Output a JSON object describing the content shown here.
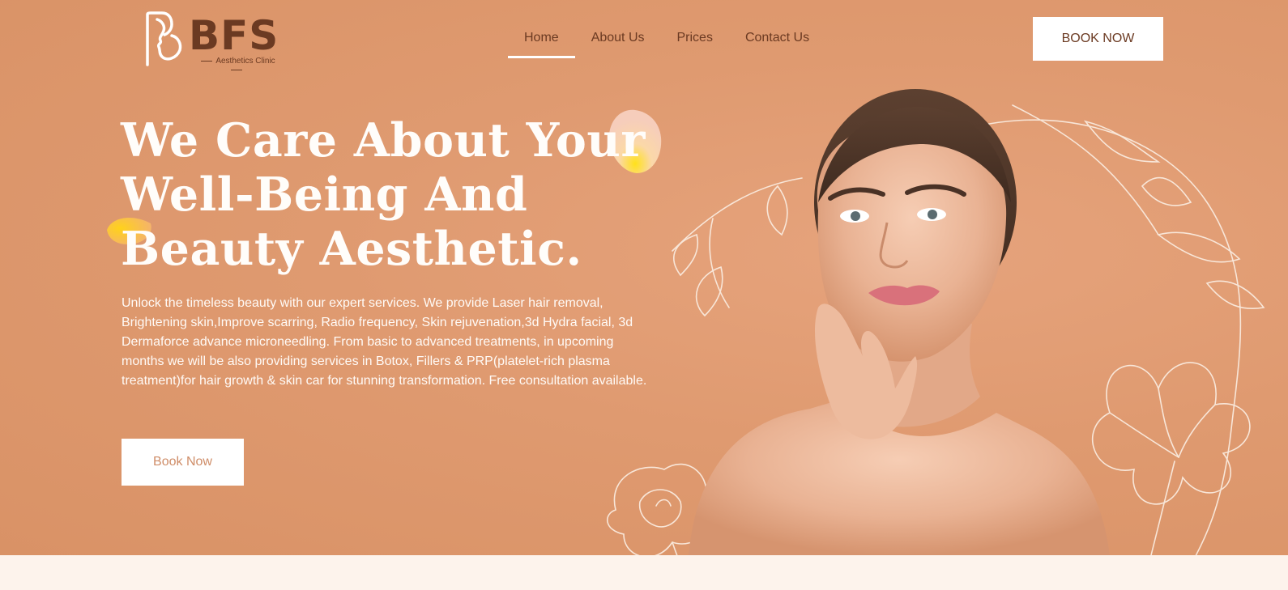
{
  "brand": {
    "name": "BFS",
    "tagline": "Aesthetics Clinic",
    "color": "#6b3a22"
  },
  "nav": {
    "items": [
      {
        "label": "Home",
        "active": true
      },
      {
        "label": "About Us",
        "active": false
      },
      {
        "label": "Prices",
        "active": false
      },
      {
        "label": "Contact Us",
        "active": false
      }
    ],
    "cta_label": "BOOK NOW"
  },
  "hero": {
    "headline_lines": [
      "We Care About Your",
      "Well-Being And",
      "Beauty Aesthetic."
    ],
    "description": "Unlock the timeless beauty with our expert services. We provide Laser hair removal, Brightening skin,Improve scarring, Radio frequency, Skin rejuvenation,3d Hydra facial, 3d Dermaforce advance microneedling. From basic to advanced treatments, in upcoming months we will be also providing services in Botox, Fillers & PRP(platelet-rich plasma treatment)for hair growth & skin car for stunning transformation. Free consultation available.",
    "cta_label": "Book Now",
    "background_color": "#df9a70",
    "accent_color": "#ffffff"
  },
  "icons": {
    "logo": "face-silhouette-logo-icon",
    "petal_top": "flower-petal-icon",
    "petal_left": "flower-petal-icon",
    "line_art": "floral-line-art-icon"
  }
}
